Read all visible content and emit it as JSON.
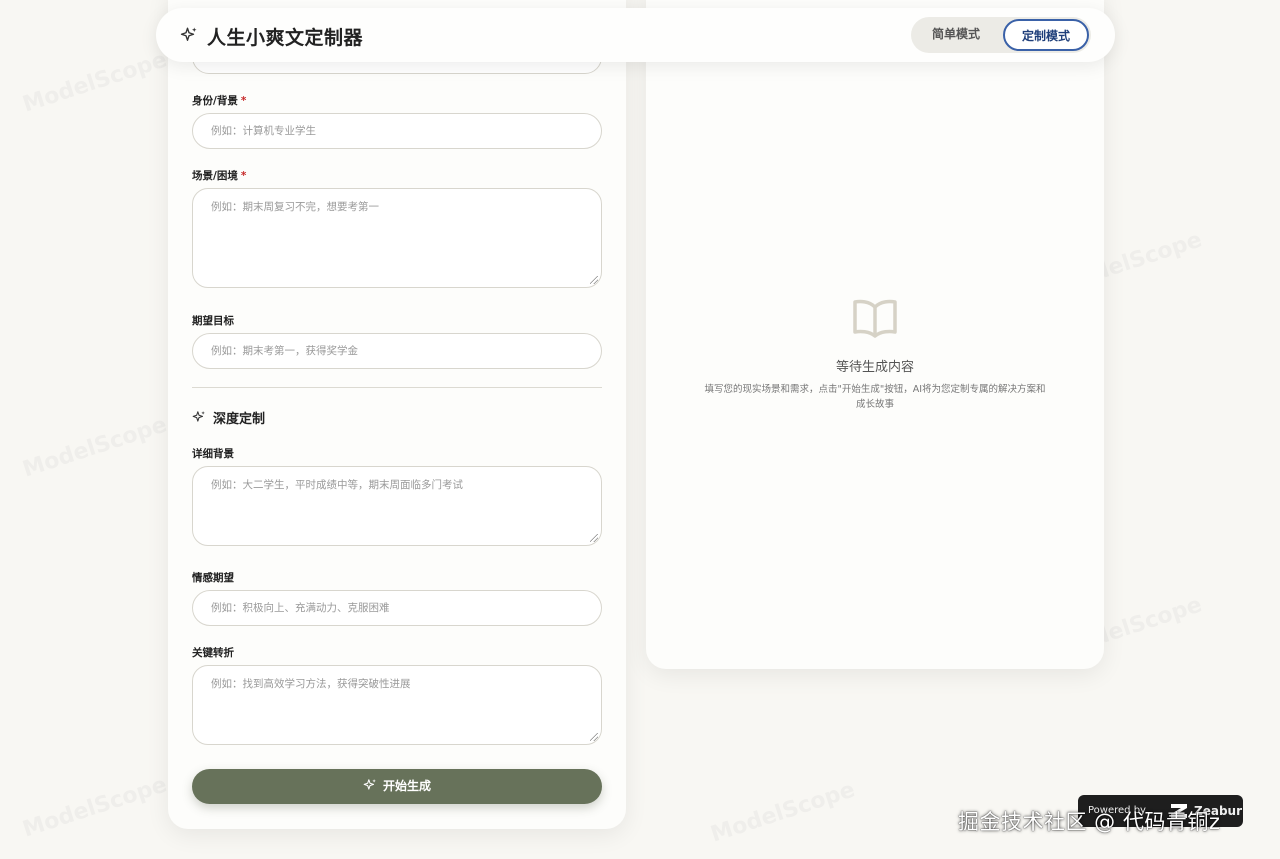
{
  "header": {
    "title": "人生小爽文定制器",
    "modes": {
      "simple": "简单模式",
      "custom": "定制模式",
      "active": "custom"
    }
  },
  "form": {
    "identity": {
      "label": "身份/背景",
      "required_mark": "*",
      "placeholder": "例如：计算机专业学生"
    },
    "scene": {
      "label": "场景/困境",
      "required_mark": "*",
      "placeholder": "例如：期末周复习不完，想要考第一"
    },
    "goal": {
      "label": "期望目标",
      "placeholder": "例如：期末考第一，获得奖学金"
    },
    "deep_section": {
      "title": "深度定制"
    },
    "detail": {
      "label": "详细背景",
      "placeholder": "例如：大二学生，平时成绩中等，期末周面临多门考试"
    },
    "emotion": {
      "label": "情感期望",
      "placeholder": "例如：积极向上、充满动力、克服困难"
    },
    "turning": {
      "label": "关键转折",
      "placeholder": "例如：找到高效学习方法，获得突破性进展"
    },
    "submit_label": "开始生成"
  },
  "result": {
    "empty_title": "等待生成内容",
    "empty_desc": "填写您的现实场景和需求，点击\"开始生成\"按钮，AI将为您定制专属的解决方案和成长故事"
  },
  "footer": {
    "powered_text": "Powered by",
    "brand": "Zeabur",
    "author": "掘金技术社区 @ 代码青铜z"
  },
  "watermark": "ModelScope",
  "colors": {
    "accent_button": "#67725a",
    "active_mode_border": "#3a61a8",
    "required": "#c62828",
    "page_bg": "#f8f7f3"
  }
}
